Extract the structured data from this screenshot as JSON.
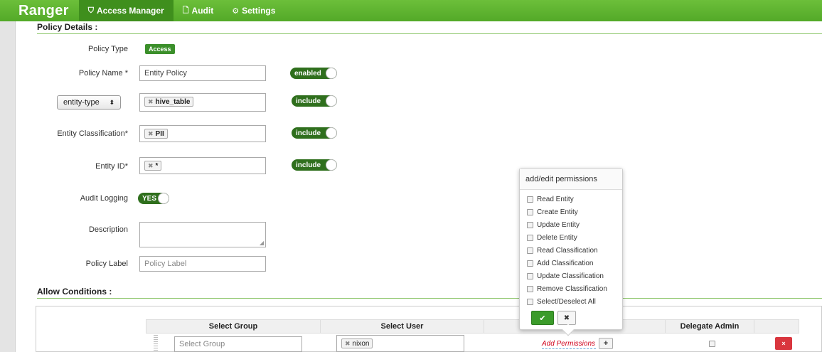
{
  "nav": {
    "brand": "Ranger",
    "items": [
      {
        "icon": "shield-icon",
        "glyph": "⛉",
        "label": "Access Manager",
        "active": true
      },
      {
        "icon": "document-icon",
        "glyph": "🗋",
        "label": "Audit",
        "active": false
      },
      {
        "icon": "gear-icon",
        "glyph": "⚙",
        "label": "Settings",
        "active": false
      }
    ]
  },
  "policy_details": {
    "section_title": "Policy Details :",
    "policy_type_label": "Policy Type",
    "policy_type_value": "Access",
    "policy_name_label": "Policy Name *",
    "policy_name_value": "Entity  Policy",
    "policy_enabled_toggle": "enabled",
    "resource_type_select": "entity-type",
    "resource_type_tag": "hive_table",
    "resource_type_toggle": "include",
    "classification_label": "Entity Classification*",
    "classification_tag": "PII",
    "classification_toggle": "include",
    "entity_id_label": "Entity ID*",
    "entity_id_tag": "*",
    "entity_id_toggle": "include",
    "audit_logging_label": "Audit Logging",
    "audit_logging_toggle": "YES",
    "description_label": "Description",
    "description_value": "",
    "policy_label_label": "Policy Label",
    "policy_label_placeholder": "Policy Label"
  },
  "allow_conditions": {
    "section_title": "Allow Conditions :",
    "columns": {
      "group": "Select Group",
      "user": "Select User",
      "delegate": "Delegate Admin"
    },
    "row": {
      "group_placeholder": "Select Group",
      "user_tag": "nixon",
      "add_permissions": "Add Permissions",
      "plus": "+",
      "delete": "×"
    }
  },
  "permissions_popover": {
    "title": "add/edit permissions",
    "options": [
      "Read Entity",
      "Create Entity",
      "Update Entity",
      "Delete Entity",
      "Read Classification",
      "Add Classification",
      "Update Classification",
      "Remove Classification",
      "Select/Deselect All"
    ],
    "ok_glyph": "✔",
    "cancel_glyph": "✖"
  },
  "colors": {
    "nav_green": "#5cb130",
    "nav_active": "#3f8f1d",
    "toggle_dark": "#2f6f1d",
    "section_line": "#8cc66a",
    "delete_red": "#d9363e",
    "add_perm_red": "#d0021b"
  }
}
